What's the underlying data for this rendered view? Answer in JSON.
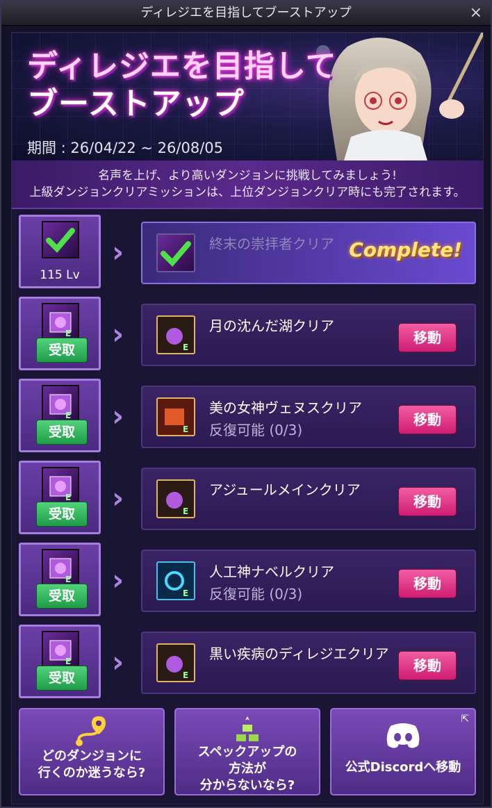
{
  "window": {
    "title": "ディレジエを目指してブーストアップ",
    "close": "×"
  },
  "banner": {
    "title_line1": "ディレジエを目指して",
    "title_line2": "ブーストアップ",
    "period": "期間 : 26/04/22 ~ 26/08/05"
  },
  "notice": {
    "line1": "名声を上げ、より高いダンジョンに挑戦してみましょう!",
    "line2": "上級ダンジョンクリアミッションは、上位ダンジョンクリア時にも完了されます。"
  },
  "rows": [
    {
      "reward_text": "115 Lv",
      "mission": "終末の崇拝者クリア",
      "sub": "",
      "status": "Complete!"
    },
    {
      "reward_text": "受取",
      "mission": "月の沈んだ湖クリア",
      "sub": "",
      "button": "移動"
    },
    {
      "reward_text": "受取",
      "mission": "美の女神ヴェヌスクリア",
      "sub": "反復可能 (0/3)",
      "button": "移動"
    },
    {
      "reward_text": "受取",
      "mission": "アジュールメインクリア",
      "sub": "",
      "button": "移動"
    },
    {
      "reward_text": "受取",
      "mission": "人工神ナベルクリア",
      "sub": "反復可能 (0/3)",
      "button": "移動"
    },
    {
      "reward_text": "受取",
      "mission": "黒い疾病のディレジエクリア",
      "sub": "",
      "button": "移動"
    }
  ],
  "bottom": {
    "btn1": {
      "line1": "どのダンジョンに",
      "line2": "行くのか迷うなら?"
    },
    "btn2": {
      "line1": "スペックアップの",
      "line2": "方法が",
      "line3": "分からないなら?"
    },
    "btn3": {
      "line1": "公式Discordへ移動"
    }
  },
  "colors": {
    "claim": "#2fb35a",
    "move": "#e43d8c",
    "panel": "#2b1a52",
    "accent": "#a57ce0"
  }
}
